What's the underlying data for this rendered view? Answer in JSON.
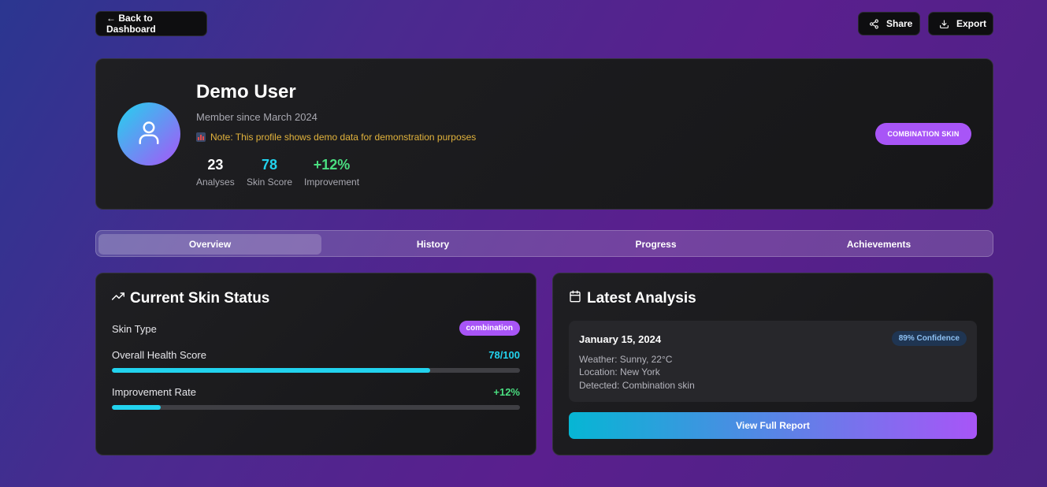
{
  "topbar": {
    "back_label": "← Back to Dashboard",
    "share_label": "Share",
    "export_label": "Export"
  },
  "profile": {
    "name": "Demo User",
    "member_since": "Member since March 2024",
    "note": "Note: This profile shows demo data for demonstration purposes",
    "skin_badge": "COMBINATION SKIN",
    "stats": [
      {
        "value": "23",
        "label": "Analyses",
        "color": "#ffffff"
      },
      {
        "value": "78",
        "label": "Skin Score",
        "color": "#22d3ee"
      },
      {
        "value": "+12%",
        "label": "Improvement",
        "color": "#4ade80"
      }
    ]
  },
  "tabs": [
    {
      "label": "Overview",
      "active": true
    },
    {
      "label": "History",
      "active": false
    },
    {
      "label": "Progress",
      "active": false
    },
    {
      "label": "Achievements",
      "active": false
    }
  ],
  "skin_status": {
    "title": "Current Skin Status",
    "skin_type_label": "Skin Type",
    "skin_type_value": "combination",
    "health_label": "Overall Health Score",
    "health_value": "78/100",
    "health_fraction": 0.78,
    "improvement_label": "Improvement Rate",
    "improvement_value": "+12%",
    "improvement_fraction": 0.12
  },
  "latest_analysis": {
    "title": "Latest Analysis",
    "date": "January 15, 2024",
    "confidence": "89% Confidence",
    "weather": "Weather: Sunny, 22°C",
    "location": "Location: New York",
    "detected": "Detected: Combination skin",
    "button_label": "View Full Report"
  },
  "colors": {
    "accent_purple": "#a855f7",
    "accent_cyan": "#22d3ee",
    "positive_green": "#4ade80",
    "note_yellow": "#e2b33c"
  }
}
